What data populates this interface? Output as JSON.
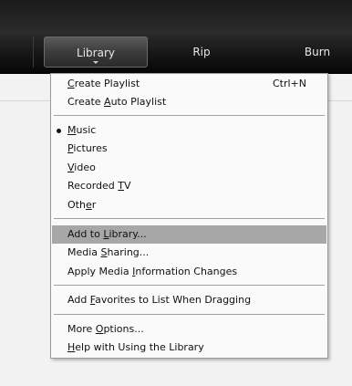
{
  "tabs": [
    {
      "label": "Library",
      "active": true
    },
    {
      "label": "Rip",
      "active": false
    },
    {
      "label": "Burn",
      "active": false
    }
  ],
  "menu": {
    "create_playlist": {
      "pre": "",
      "key": "C",
      "post": "reate Playlist",
      "shortcut": "Ctrl+N"
    },
    "create_auto_playlist": {
      "pre": "Create ",
      "key": "A",
      "post": "uto Playlist"
    },
    "music": {
      "pre": "",
      "key": "M",
      "post": "usic",
      "selected": true
    },
    "pictures": {
      "pre": "",
      "key": "P",
      "post": "ictures"
    },
    "video": {
      "pre": "",
      "key": "V",
      "post": "ideo"
    },
    "recorded_tv": {
      "pre": "Recorded ",
      "key": "T",
      "post": "V"
    },
    "other": {
      "pre": "Oth",
      "key": "e",
      "post": "r"
    },
    "add_to_library": {
      "pre": "Add to ",
      "key": "L",
      "post": "ibrary...",
      "highlighted": true
    },
    "media_sharing": {
      "pre": "Media ",
      "key": "S",
      "post": "haring..."
    },
    "apply_media_info": {
      "pre": "Apply Media ",
      "key": "I",
      "post": "nformation Changes"
    },
    "add_favorites": {
      "pre": "Add ",
      "key": "F",
      "post": "avorites to List When Dragging"
    },
    "more_options": {
      "pre": "More ",
      "key": "O",
      "post": "ptions..."
    },
    "help": {
      "pre": "",
      "key": "H",
      "post": "elp with Using the Library"
    }
  },
  "colors": {
    "highlight": "#a7a7a7",
    "menu_bg": "#fafafa",
    "tabbar": "#1a1a1a"
  }
}
